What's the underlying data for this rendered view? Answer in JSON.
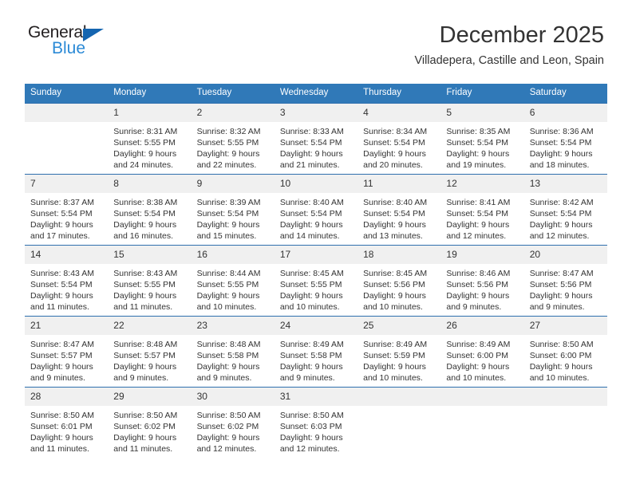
{
  "brand": {
    "name_dark": "General",
    "name_light": "Blue",
    "accent_dark": "#231f20",
    "accent_blue": "#2b8ad6",
    "triangle_blue": "#1565b0"
  },
  "header": {
    "title": "December 2025",
    "subtitle": "Villadepera, Castille and Leon, Spain"
  },
  "theme": {
    "header_row_bg": "#3079b8",
    "row_divider": "#2f6fae",
    "daynum_bg": "#f0f0f0"
  },
  "weekdays": [
    "Sunday",
    "Monday",
    "Tuesday",
    "Wednesday",
    "Thursday",
    "Friday",
    "Saturday"
  ],
  "weeks": [
    [
      {
        "day": "",
        "lines": []
      },
      {
        "day": "1",
        "lines": [
          "Sunrise: 8:31 AM",
          "Sunset: 5:55 PM",
          "Daylight: 9 hours",
          "and 24 minutes."
        ]
      },
      {
        "day": "2",
        "lines": [
          "Sunrise: 8:32 AM",
          "Sunset: 5:55 PM",
          "Daylight: 9 hours",
          "and 22 minutes."
        ]
      },
      {
        "day": "3",
        "lines": [
          "Sunrise: 8:33 AM",
          "Sunset: 5:54 PM",
          "Daylight: 9 hours",
          "and 21 minutes."
        ]
      },
      {
        "day": "4",
        "lines": [
          "Sunrise: 8:34 AM",
          "Sunset: 5:54 PM",
          "Daylight: 9 hours",
          "and 20 minutes."
        ]
      },
      {
        "day": "5",
        "lines": [
          "Sunrise: 8:35 AM",
          "Sunset: 5:54 PM",
          "Daylight: 9 hours",
          "and 19 minutes."
        ]
      },
      {
        "day": "6",
        "lines": [
          "Sunrise: 8:36 AM",
          "Sunset: 5:54 PM",
          "Daylight: 9 hours",
          "and 18 minutes."
        ]
      }
    ],
    [
      {
        "day": "7",
        "lines": [
          "Sunrise: 8:37 AM",
          "Sunset: 5:54 PM",
          "Daylight: 9 hours",
          "and 17 minutes."
        ]
      },
      {
        "day": "8",
        "lines": [
          "Sunrise: 8:38 AM",
          "Sunset: 5:54 PM",
          "Daylight: 9 hours",
          "and 16 minutes."
        ]
      },
      {
        "day": "9",
        "lines": [
          "Sunrise: 8:39 AM",
          "Sunset: 5:54 PM",
          "Daylight: 9 hours",
          "and 15 minutes."
        ]
      },
      {
        "day": "10",
        "lines": [
          "Sunrise: 8:40 AM",
          "Sunset: 5:54 PM",
          "Daylight: 9 hours",
          "and 14 minutes."
        ]
      },
      {
        "day": "11",
        "lines": [
          "Sunrise: 8:40 AM",
          "Sunset: 5:54 PM",
          "Daylight: 9 hours",
          "and 13 minutes."
        ]
      },
      {
        "day": "12",
        "lines": [
          "Sunrise: 8:41 AM",
          "Sunset: 5:54 PM",
          "Daylight: 9 hours",
          "and 12 minutes."
        ]
      },
      {
        "day": "13",
        "lines": [
          "Sunrise: 8:42 AM",
          "Sunset: 5:54 PM",
          "Daylight: 9 hours",
          "and 12 minutes."
        ]
      }
    ],
    [
      {
        "day": "14",
        "lines": [
          "Sunrise: 8:43 AM",
          "Sunset: 5:54 PM",
          "Daylight: 9 hours",
          "and 11 minutes."
        ]
      },
      {
        "day": "15",
        "lines": [
          "Sunrise: 8:43 AM",
          "Sunset: 5:55 PM",
          "Daylight: 9 hours",
          "and 11 minutes."
        ]
      },
      {
        "day": "16",
        "lines": [
          "Sunrise: 8:44 AM",
          "Sunset: 5:55 PM",
          "Daylight: 9 hours",
          "and 10 minutes."
        ]
      },
      {
        "day": "17",
        "lines": [
          "Sunrise: 8:45 AM",
          "Sunset: 5:55 PM",
          "Daylight: 9 hours",
          "and 10 minutes."
        ]
      },
      {
        "day": "18",
        "lines": [
          "Sunrise: 8:45 AM",
          "Sunset: 5:56 PM",
          "Daylight: 9 hours",
          "and 10 minutes."
        ]
      },
      {
        "day": "19",
        "lines": [
          "Sunrise: 8:46 AM",
          "Sunset: 5:56 PM",
          "Daylight: 9 hours",
          "and 9 minutes."
        ]
      },
      {
        "day": "20",
        "lines": [
          "Sunrise: 8:47 AM",
          "Sunset: 5:56 PM",
          "Daylight: 9 hours",
          "and 9 minutes."
        ]
      }
    ],
    [
      {
        "day": "21",
        "lines": [
          "Sunrise: 8:47 AM",
          "Sunset: 5:57 PM",
          "Daylight: 9 hours",
          "and 9 minutes."
        ]
      },
      {
        "day": "22",
        "lines": [
          "Sunrise: 8:48 AM",
          "Sunset: 5:57 PM",
          "Daylight: 9 hours",
          "and 9 minutes."
        ]
      },
      {
        "day": "23",
        "lines": [
          "Sunrise: 8:48 AM",
          "Sunset: 5:58 PM",
          "Daylight: 9 hours",
          "and 9 minutes."
        ]
      },
      {
        "day": "24",
        "lines": [
          "Sunrise: 8:49 AM",
          "Sunset: 5:58 PM",
          "Daylight: 9 hours",
          "and 9 minutes."
        ]
      },
      {
        "day": "25",
        "lines": [
          "Sunrise: 8:49 AM",
          "Sunset: 5:59 PM",
          "Daylight: 9 hours",
          "and 10 minutes."
        ]
      },
      {
        "day": "26",
        "lines": [
          "Sunrise: 8:49 AM",
          "Sunset: 6:00 PM",
          "Daylight: 9 hours",
          "and 10 minutes."
        ]
      },
      {
        "day": "27",
        "lines": [
          "Sunrise: 8:50 AM",
          "Sunset: 6:00 PM",
          "Daylight: 9 hours",
          "and 10 minutes."
        ]
      }
    ],
    [
      {
        "day": "28",
        "lines": [
          "Sunrise: 8:50 AM",
          "Sunset: 6:01 PM",
          "Daylight: 9 hours",
          "and 11 minutes."
        ]
      },
      {
        "day": "29",
        "lines": [
          "Sunrise: 8:50 AM",
          "Sunset: 6:02 PM",
          "Daylight: 9 hours",
          "and 11 minutes."
        ]
      },
      {
        "day": "30",
        "lines": [
          "Sunrise: 8:50 AM",
          "Sunset: 6:02 PM",
          "Daylight: 9 hours",
          "and 12 minutes."
        ]
      },
      {
        "day": "31",
        "lines": [
          "Sunrise: 8:50 AM",
          "Sunset: 6:03 PM",
          "Daylight: 9 hours",
          "and 12 minutes."
        ]
      },
      {
        "day": "",
        "lines": []
      },
      {
        "day": "",
        "lines": []
      },
      {
        "day": "",
        "lines": []
      }
    ]
  ]
}
